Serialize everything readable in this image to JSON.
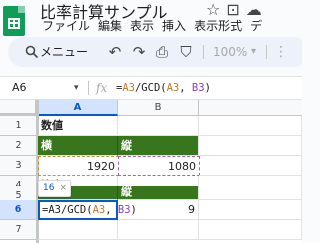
{
  "app": {
    "title": "比率計算サンプル",
    "title_icons": [
      "star-icon",
      "move-to-folder-icon",
      "cloud-status-icon"
    ]
  },
  "menu": {
    "items": [
      "ファイル",
      "編集",
      "表示",
      "挿入",
      "表示形式",
      "デ"
    ]
  },
  "toolbar": {
    "search_label": "メニュー",
    "zoom": "100%",
    "zoom_caret": "▾",
    "more": "⋮"
  },
  "formula_bar": {
    "cell_ref": "A6",
    "fx": "fx",
    "formula_prefix": "=",
    "ref_a1": "A3",
    "mid": "/GCD(",
    "ref_a2": "A3",
    "comma": ", ",
    "ref_b": "B3",
    "close": ")"
  },
  "grid": {
    "columns": [
      "A",
      "B"
    ],
    "rows": [
      "1",
      "2",
      "3",
      "4",
      "5",
      "6",
      "7"
    ],
    "cells": {
      "a1": "数値",
      "a2": "横",
      "b2": "縦",
      "a3": "1920",
      "b3": "1080",
      "a4": "比率",
      "b5": "縦",
      "b6": "9"
    },
    "active_cell": {
      "text_prefix": "=A3/GCD(",
      "ref_a": "A3",
      "comma": ", ",
      "ref_b": "B3",
      "close": ")"
    },
    "hint_chip": {
      "value": "16",
      "close": "×"
    }
  },
  "colors": {
    "header_green": "#38761d",
    "selection_blue": "#0b57d0",
    "ref_a_orange": "#c2772a",
    "ref_b_purple": "#8e3eb5"
  }
}
